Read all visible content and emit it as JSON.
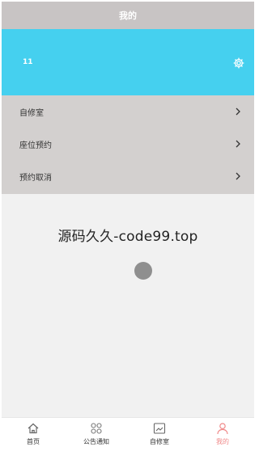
{
  "header": {
    "title": "我的"
  },
  "profile": {
    "uid": "11"
  },
  "menu": {
    "items": [
      {
        "label": "自修室"
      },
      {
        "label": "座位预约"
      },
      {
        "label": "预约取消"
      }
    ]
  },
  "watermark": {
    "text": "源码久久-code99.top"
  },
  "tabbar": {
    "tabs": [
      {
        "label": "首页",
        "icon": "home-icon"
      },
      {
        "label": "公告通知",
        "icon": "notice-icon"
      },
      {
        "label": "自修室",
        "icon": "study-room-icon"
      },
      {
        "label": "我的",
        "icon": "user-icon",
        "active": true
      }
    ]
  },
  "colors": {
    "accent": "#45d0ef",
    "header": "#c8c4c4",
    "active_tab": "#f08a8a"
  }
}
